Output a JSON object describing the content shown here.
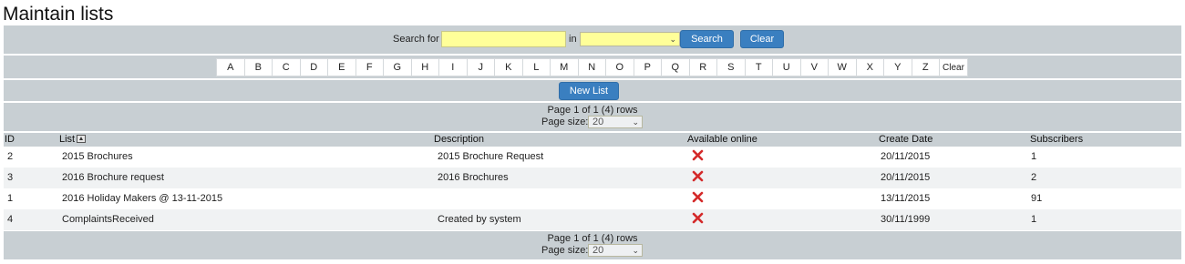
{
  "page": {
    "title": "Maintain lists"
  },
  "search": {
    "label": "Search for",
    "value": "",
    "in_label": "in",
    "field_selected": "",
    "search_button": "Search",
    "clear_button": "Clear"
  },
  "alphabet": {
    "letters": [
      "A",
      "B",
      "C",
      "D",
      "E",
      "F",
      "G",
      "H",
      "I",
      "J",
      "K",
      "L",
      "M",
      "N",
      "O",
      "P",
      "Q",
      "R",
      "S",
      "T",
      "U",
      "V",
      "W",
      "X",
      "Y",
      "Z"
    ],
    "clear": "Clear"
  },
  "actions": {
    "new_list": "New List"
  },
  "pager": {
    "text": "Page 1 of 1 (4) rows",
    "size_label": "Page size:",
    "size_value": "20"
  },
  "table": {
    "headers": {
      "id": "ID",
      "list": "List",
      "description": "Description",
      "available": "Available online",
      "create_date": "Create Date",
      "subscribers": "Subscribers"
    },
    "rows": [
      {
        "id": "2",
        "list": "2015 Brochures",
        "description": "2015 Brochure Request",
        "available": "no",
        "create_date": "20/11/2015",
        "subscribers": "1"
      },
      {
        "id": "3",
        "list": "2016 Brochure request",
        "description": "2016 Brochures",
        "available": "no",
        "create_date": "20/11/2015",
        "subscribers": "2"
      },
      {
        "id": "1",
        "list": "2016 Holiday Makers @ 13-11-2015",
        "description": "",
        "available": "no",
        "create_date": "13/11/2015",
        "subscribers": "91"
      },
      {
        "id": "4",
        "list": "ComplaintsReceived",
        "description": "Created by system",
        "available": "no",
        "create_date": "30/11/1999",
        "subscribers": "1"
      }
    ]
  },
  "colors": {
    "band": "#c8cfd3",
    "button": "#3a7fc0",
    "input_highlight": "#ffff99",
    "cross": "#d42a2a"
  },
  "icons": {
    "sort": "sort-ascending-icon",
    "unavailable": "red-cross-icon",
    "dropdown": "chevron-down-icon"
  }
}
